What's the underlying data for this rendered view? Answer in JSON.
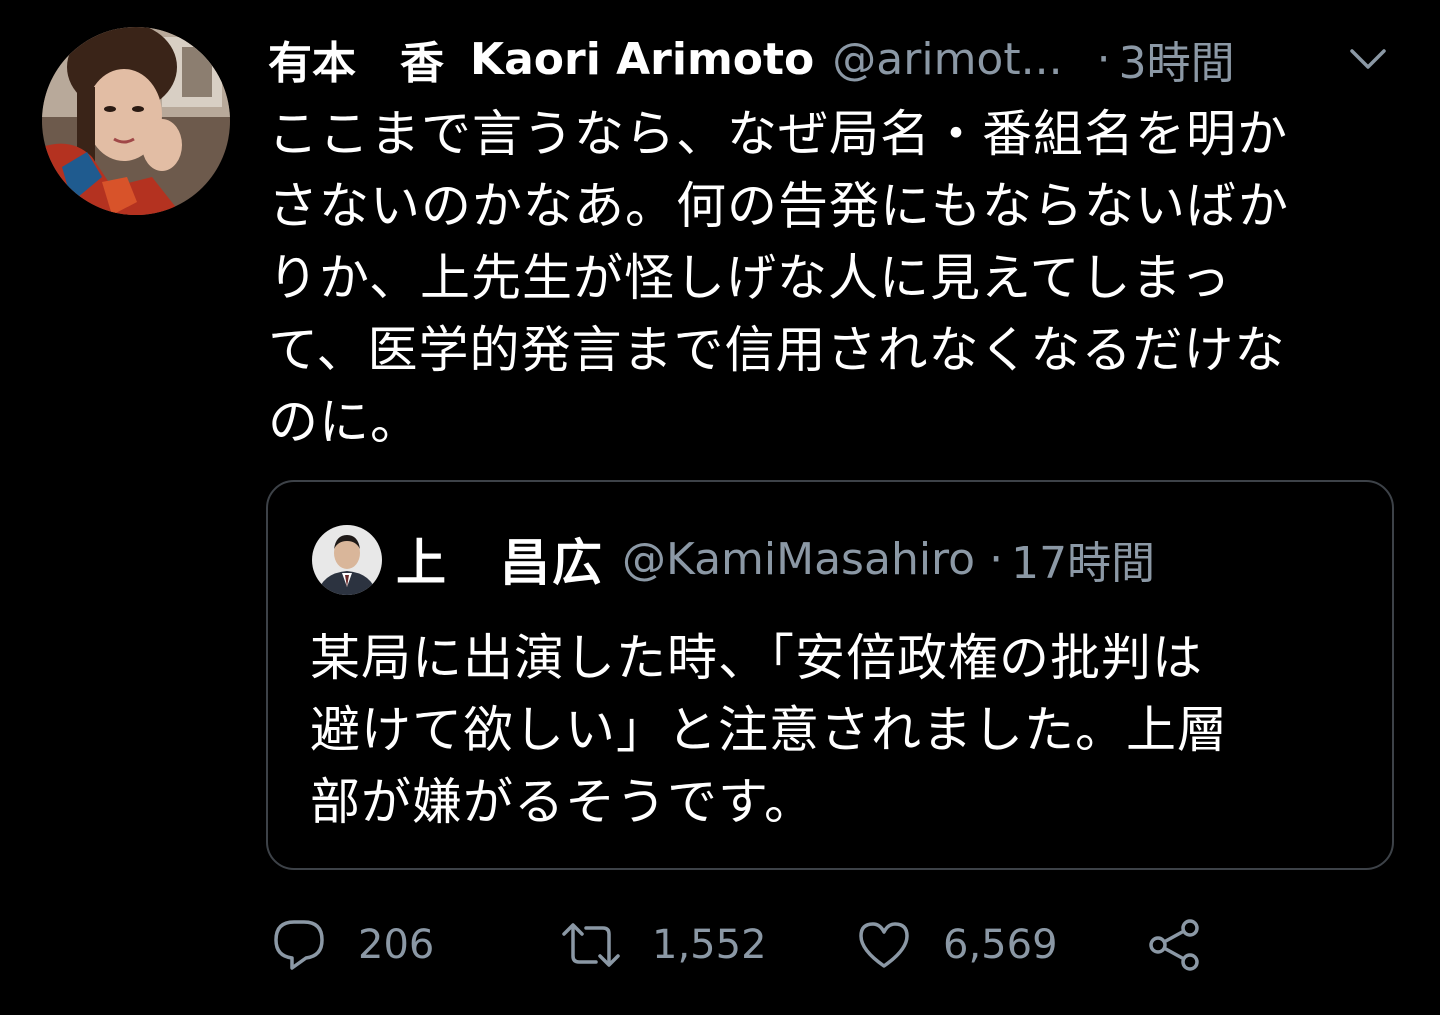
{
  "tweet": {
    "display_name": "有本　香",
    "display_name_en": "Kaori Arimoto",
    "handle": "@arimot...",
    "time": "3時間",
    "text_lines": [
      "ここまで言うなら、なぜ局名・番組名を明か",
      "さないのかなあ。何の告発にもならないばか",
      "りか、上先生が怪しげな人に見えてしまっ",
      "て、医学的発言まで信用されなくなるだけな",
      "のに。"
    ]
  },
  "quoted_tweet": {
    "display_name": "上　昌広",
    "handle": "@KamiMasahiro",
    "time": "17時間",
    "text_lines": [
      "某局に出演した時、「安倍政権の批判は",
      "避けて欲しい」と注意されました。上層",
      "部が嫌がるそうです。"
    ]
  },
  "actions": {
    "replies": "206",
    "retweets": "1,552",
    "likes": "6,569"
  },
  "colors": {
    "background": "#000000",
    "primary_text": "#ffffff",
    "secondary_text": "#8b98a5",
    "card_border": "#3d4248"
  },
  "icons": [
    "reply-icon",
    "retweet-icon",
    "like-icon",
    "share-icon",
    "chevron-down-icon"
  ]
}
